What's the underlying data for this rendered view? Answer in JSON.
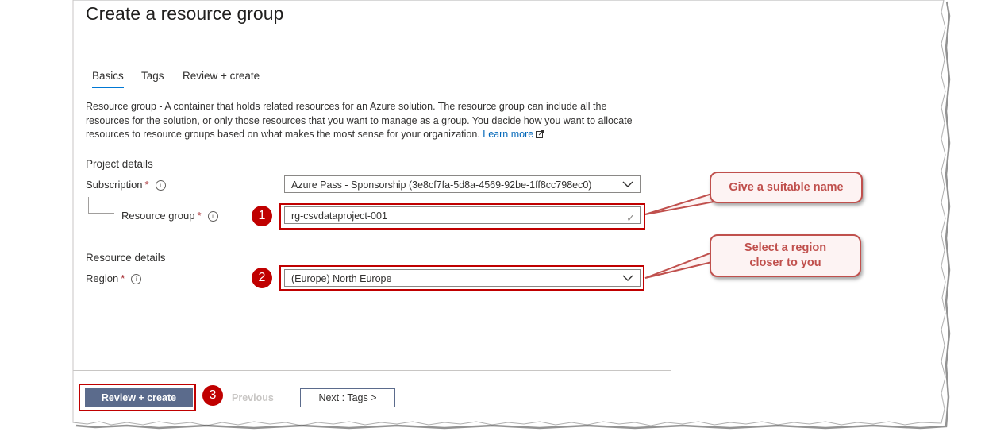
{
  "page": {
    "title": "Create a resource group"
  },
  "tabs": [
    {
      "label": "Basics",
      "active": true
    },
    {
      "label": "Tags",
      "active": false
    },
    {
      "label": "Review + create",
      "active": false
    }
  ],
  "description": {
    "term": "Resource group",
    "text": " - A container that holds related resources for an Azure solution. The resource group can include all the resources for the solution, or only those resources that you want to manage as a group. You decide how you want to allocate resources to resource groups based on what makes the most sense for your organization. ",
    "learn_more": "Learn more"
  },
  "project_details": {
    "heading": "Project details",
    "subscription_label": "Subscription",
    "subscription_value": "Azure Pass - Sponsorship (3e8cf7fa-5d8a-4569-92be-1ff8cc798ec0)",
    "resource_group_label": "Resource group",
    "resource_group_value": "rg-csvdataproject-001"
  },
  "resource_details": {
    "heading": "Resource details",
    "region_label": "Region",
    "region_value": "(Europe) North Europe"
  },
  "required_mark": "*",
  "info_glyph": "i",
  "footer": {
    "review_create": "Review + create",
    "previous": "Previous",
    "next": "Next : Tags >"
  },
  "annotations": {
    "badge_1": "1",
    "badge_2": "2",
    "badge_3": "3",
    "callout_name": "Give a suitable name",
    "callout_region_line1": "Select a region",
    "callout_region_line2": "closer to you"
  },
  "colors": {
    "accent": "#0078d4",
    "annotation_red": "#c00000",
    "primary_button": "#5b6b8c"
  }
}
